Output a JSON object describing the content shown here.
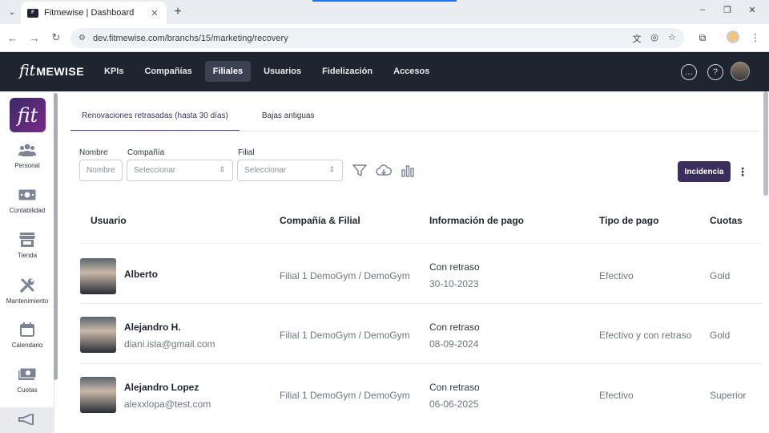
{
  "browser": {
    "tab_title": "Fitmewise | Dashboard",
    "url": "dev.fitmewise.com/branchs/15/marketing/recovery"
  },
  "app": {
    "logo_fit": "fit",
    "logo_rest": "MEWISE",
    "nav": [
      {
        "label": "KPIs",
        "active": false
      },
      {
        "label": "Compañías",
        "active": false
      },
      {
        "label": "Filiales",
        "active": true
      },
      {
        "label": "Usuarios",
        "active": false
      },
      {
        "label": "Fidelización",
        "active": false
      },
      {
        "label": "Accesos",
        "active": false
      }
    ]
  },
  "sidebar": {
    "logo": "fit",
    "items": [
      {
        "label": "Personal",
        "icon": "users-icon"
      },
      {
        "label": "Contabilidad",
        "icon": "money-icon"
      },
      {
        "label": "Tienda",
        "icon": "store-icon"
      },
      {
        "label": "Mantenimiento",
        "icon": "tools-icon"
      },
      {
        "label": "Calendario",
        "icon": "calendar-icon"
      },
      {
        "label": "Cuotas",
        "icon": "cash-icon"
      }
    ]
  },
  "main": {
    "tabs": [
      "Renovaciones retrasadas (hasta 30 días)",
      "Bajas antiguas"
    ],
    "filters": {
      "nombre_label": "Nombre",
      "nombre_placeholder": "Nombre",
      "compania_label": "Compañía",
      "compania_value": "Seleccionar",
      "filial_label": "Filial",
      "filial_value": "Seleccionar"
    },
    "incidencia_label": "Incidencia",
    "table": {
      "headers": [
        "Usuario",
        "Compañía & Filial",
        "Información de pago",
        "Tipo de pago",
        "Cuotas"
      ],
      "rows": [
        {
          "name": "Alberto",
          "email": "",
          "company": "Filial 1 DemoGym / DemoGym",
          "pay_status": "Con retraso",
          "pay_date": "30-10-2023",
          "pay_type": "Efectivo",
          "quota": "Gold"
        },
        {
          "name": "Alejandro H.",
          "email": "diani.isla@gmail.com",
          "company": "Filial 1 DemoGym / DemoGym",
          "pay_status": "Con retraso",
          "pay_date": "08-09-2024",
          "pay_type": "Efectivo y con retraso",
          "quota": "Gold"
        },
        {
          "name": "Alejandro Lopez",
          "email": "alexxlopa@test.com",
          "company": "Filial 1 DemoGym / DemoGym",
          "pay_status": "Con retraso",
          "pay_date": "06-06-2025",
          "pay_type": "Efectivo",
          "quota": "Superior"
        }
      ]
    }
  }
}
